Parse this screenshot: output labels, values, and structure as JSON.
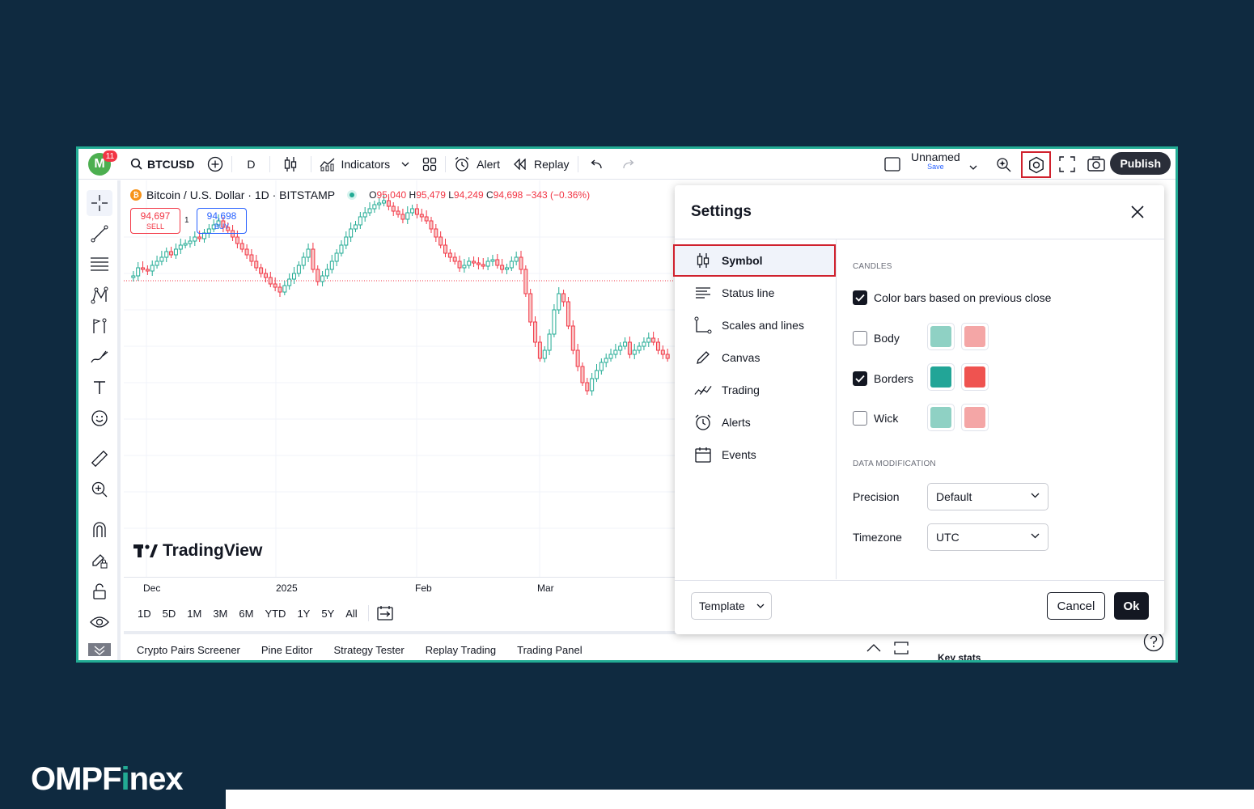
{
  "toolbar": {
    "avatar_letter": "M",
    "notifications": "11",
    "symbol": "BTCUSD",
    "interval": "D",
    "indicators": "Indicators",
    "alert": "Alert",
    "replay": "Replay",
    "layout_name": "Unnamed",
    "layout_save": "Save",
    "publish": "Publish"
  },
  "chart": {
    "title": "Bitcoin / U.S. Dollar · 1D · BITSTAMP",
    "btc_symbol": "₿",
    "open_label": "O",
    "open": "95,040",
    "high_label": "H",
    "high": "95,479",
    "low_label": "L",
    "low": "94,249",
    "close_label": "C",
    "close": "94,698",
    "change": "−343 (−0.36%)",
    "sell_price": "94,697",
    "sell_label": "SELL",
    "buy_price": "94,698",
    "buy_label": "BUY",
    "spread": "1",
    "watermark": "TradingView",
    "time_labels": [
      "Dec",
      "2025",
      "Feb",
      "Mar"
    ],
    "colors": {
      "up": "#22ab94",
      "down": "#f23645"
    }
  },
  "ranges": [
    "1D",
    "5D",
    "1M",
    "3M",
    "6M",
    "YTD",
    "1Y",
    "5Y",
    "All"
  ],
  "bottom_tabs": [
    "Crypto Pairs Screener",
    "Pine Editor",
    "Strategy Tester",
    "Replay Trading",
    "Trading Panel"
  ],
  "right_panel": {
    "key_stats": "Key stats"
  },
  "settings": {
    "title": "Settings",
    "nav": [
      {
        "label": "Symbol",
        "icon": "candles-icon"
      },
      {
        "label": "Status line",
        "icon": "status-line-icon"
      },
      {
        "label": "Scales and lines",
        "icon": "scales-icon"
      },
      {
        "label": "Canvas",
        "icon": "pencil-icon"
      },
      {
        "label": "Trading",
        "icon": "trading-icon"
      },
      {
        "label": "Alerts",
        "icon": "alarm-icon"
      },
      {
        "label": "Events",
        "icon": "calendar-icon"
      }
    ],
    "candles_header": "CANDLES",
    "color_bars": {
      "label": "Color bars based on previous close",
      "checked": true
    },
    "body": {
      "label": "Body",
      "checked": false,
      "up": "#8fd1c4",
      "down": "#f4a6a6"
    },
    "borders": {
      "label": "Borders",
      "checked": true,
      "up": "#22a597",
      "down": "#ef5350"
    },
    "wick": {
      "label": "Wick",
      "checked": false,
      "up": "#8fd1c4",
      "down": "#f4a6a6"
    },
    "data_header": "DATA MODIFICATION",
    "precision_label": "Precision",
    "precision_value": "Default",
    "timezone_label": "Timezone",
    "timezone_value": "UTC",
    "template": "Template",
    "cancel": "Cancel",
    "ok": "Ok"
  },
  "brand": {
    "pre": "OMPF",
    "i": "i",
    "post": "nex"
  }
}
